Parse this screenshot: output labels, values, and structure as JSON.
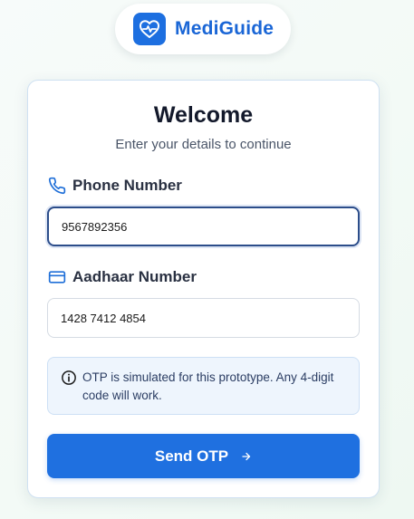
{
  "brand": {
    "name": "MediGuide",
    "icon": "heart-pulse-icon",
    "color": "#1d6fe0"
  },
  "card": {
    "title": "Welcome",
    "subtitle": "Enter your details to continue"
  },
  "phone": {
    "label": "Phone Number",
    "icon": "phone-icon",
    "value": "9567892356"
  },
  "aadhaar": {
    "label": "Aadhaar Number",
    "icon": "id-card-icon",
    "value": "1428 7412 4854"
  },
  "notice": {
    "icon": "info-icon",
    "text": "OTP is simulated for this prototype. Any 4-digit code will work."
  },
  "submit": {
    "label": "Send OTP",
    "icon": "arrow-right-icon",
    "color": "#1f70e0"
  }
}
